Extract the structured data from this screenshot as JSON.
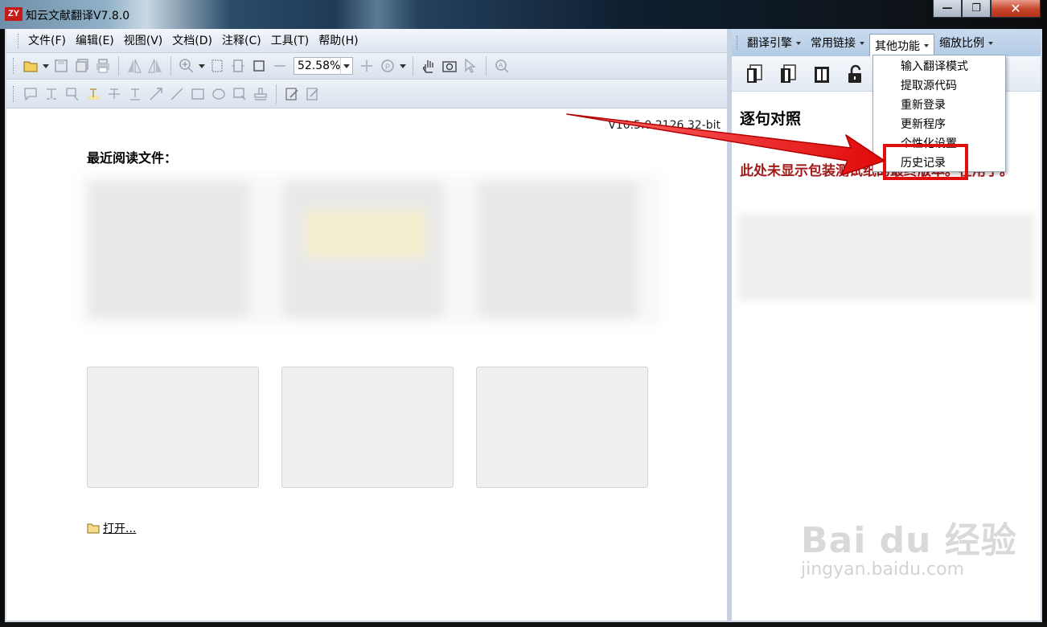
{
  "window": {
    "logo": "ZY",
    "title": "知云文献翻译V7.8.0",
    "minimize": "—",
    "maximize": "❐",
    "close": "✕"
  },
  "menubar": [
    "文件(F)",
    "编辑(E)",
    "视图(V)",
    "文档(D)",
    "注释(C)",
    "工具(T)",
    "帮助(H)"
  ],
  "toolbar": {
    "zoom_value": "52.58%"
  },
  "left_pane": {
    "version": "V10.5.0.2126 32-bit",
    "recent_title": "最近阅读文件：",
    "open_label": "打开..."
  },
  "right_pane": {
    "menus": [
      "翻译引擎",
      "常用链接",
      "其他功能",
      "缩放比例"
    ],
    "heading": "逐句对照",
    "notice": "此处未显示包装测试纸的最终版本。在用于。"
  },
  "dropdown": {
    "items": [
      "输入翻译模式",
      "提取源代码",
      "重新登录",
      "更新程序",
      "个性化设置",
      "历史记录"
    ],
    "highlighted_index": 5
  },
  "watermark": {
    "brand": "Bai du 经验",
    "url": "jingyan.baidu.com"
  },
  "colors": {
    "accent_red": "#e01010",
    "notice_red": "#a11a1a",
    "right_menubar": "#b3cbe5"
  }
}
